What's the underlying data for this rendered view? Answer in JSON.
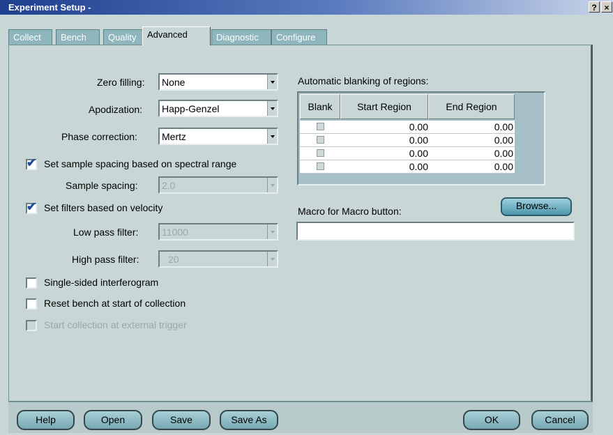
{
  "window": {
    "title": "Experiment Setup -",
    "help_btn": "?",
    "close_btn": "×"
  },
  "tabs": [
    "Collect",
    "Bench",
    "Quality",
    "Advanced",
    "Diagnostic",
    "Configure"
  ],
  "left": {
    "zero_filling": {
      "label": "Zero filling:",
      "value": "None"
    },
    "apodization": {
      "label": "Apodization:",
      "value": "Happ-Genzel"
    },
    "phase_correction": {
      "label": "Phase correction:",
      "value": "Mertz"
    },
    "set_sample_spacing": {
      "label": "Set sample spacing based on spectral range",
      "checked": true
    },
    "sample_spacing": {
      "label": "Sample spacing:",
      "value": "2.0"
    },
    "set_filters": {
      "label": "Set filters based on velocity",
      "checked": true
    },
    "low_pass": {
      "label": "Low pass filter:",
      "value": "11000"
    },
    "high_pass": {
      "label": "High pass filter:",
      "value": "20"
    },
    "single_sided": {
      "label": "Single-sided interferogram",
      "checked": false
    },
    "reset_bench": {
      "label": "Reset bench at start of collection",
      "checked": false
    },
    "external_trigger": {
      "label": "Start collection at external trigger",
      "checked": false,
      "disabled": true
    }
  },
  "blanking": {
    "label": "Automatic blanking of regions:",
    "headers": [
      "Blank",
      "Start Region",
      "End Region"
    ],
    "rows": [
      {
        "start": "0.00",
        "end": "0.00"
      },
      {
        "start": "0.00",
        "end": "0.00"
      },
      {
        "start": "0.00",
        "end": "0.00"
      },
      {
        "start": "0.00",
        "end": "0.00"
      }
    ]
  },
  "macro": {
    "label": "Macro for Macro button:",
    "value": "",
    "browse": "Browse..."
  },
  "buttons": {
    "help": "Help",
    "open": "Open",
    "save": "Save",
    "save_as": "Save As",
    "ok": "OK",
    "cancel": "Cancel"
  }
}
